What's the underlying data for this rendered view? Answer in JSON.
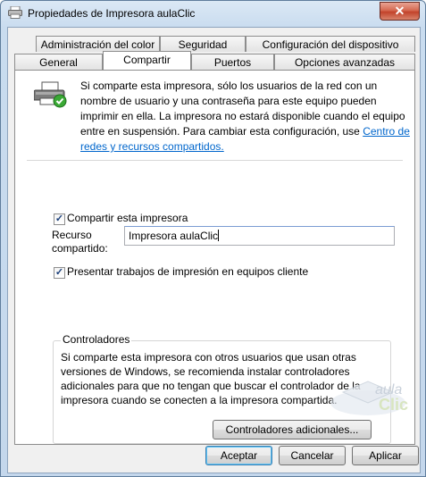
{
  "window": {
    "title": "Propiedades de Impresora aulaClic",
    "close_glyph": "✕"
  },
  "tabs": {
    "row_back": [
      "Administración del color",
      "Seguridad",
      "Configuración del dispositivo"
    ],
    "row_front": [
      "General",
      "Compartir",
      "Puertos",
      "Opciones avanzadas"
    ],
    "active": "Compartir"
  },
  "sharing": {
    "intro_text": "Si comparte esta impresora, sólo los usuarios de la red con un nombre de usuario y una contraseña para este equipo pueden imprimir en ella. La impresora no estará disponible cuando el equipo entre en suspensión. Para cambiar esta configuración, use ",
    "intro_link": "Centro de redes y recursos compartidos.",
    "share_checkbox_label": "Compartir esta impresora",
    "share_checked": true,
    "share_name_label_line1": "Recurso",
    "share_name_label_line2": "compartido:",
    "share_name_value": "Impresora aulaClic",
    "render_jobs_label": "Presentar trabajos de impresión en equipos cliente",
    "render_jobs_checked": true
  },
  "drivers": {
    "legend": "Controladores",
    "text": "Si comparte esta impresora con otros usuarios que usan otras versiones de Windows, se recomienda instalar controladores adicionales para que no tengan que buscar el controlador de la impresora cuando se conecten a la impresora compartida.",
    "additional_button": "Controladores adicionales..."
  },
  "buttons": {
    "ok": "Aceptar",
    "cancel": "Cancelar",
    "apply": "Aplicar"
  },
  "watermark": {
    "line1": "aula",
    "line2": "Clic"
  },
  "colors": {
    "link": "#0066cc",
    "title_bar": "#c9dcef",
    "close_button": "#c2432b"
  },
  "icons": [
    "printer-icon",
    "printer-share-icon",
    "close-icon",
    "checkmark-icon"
  ]
}
